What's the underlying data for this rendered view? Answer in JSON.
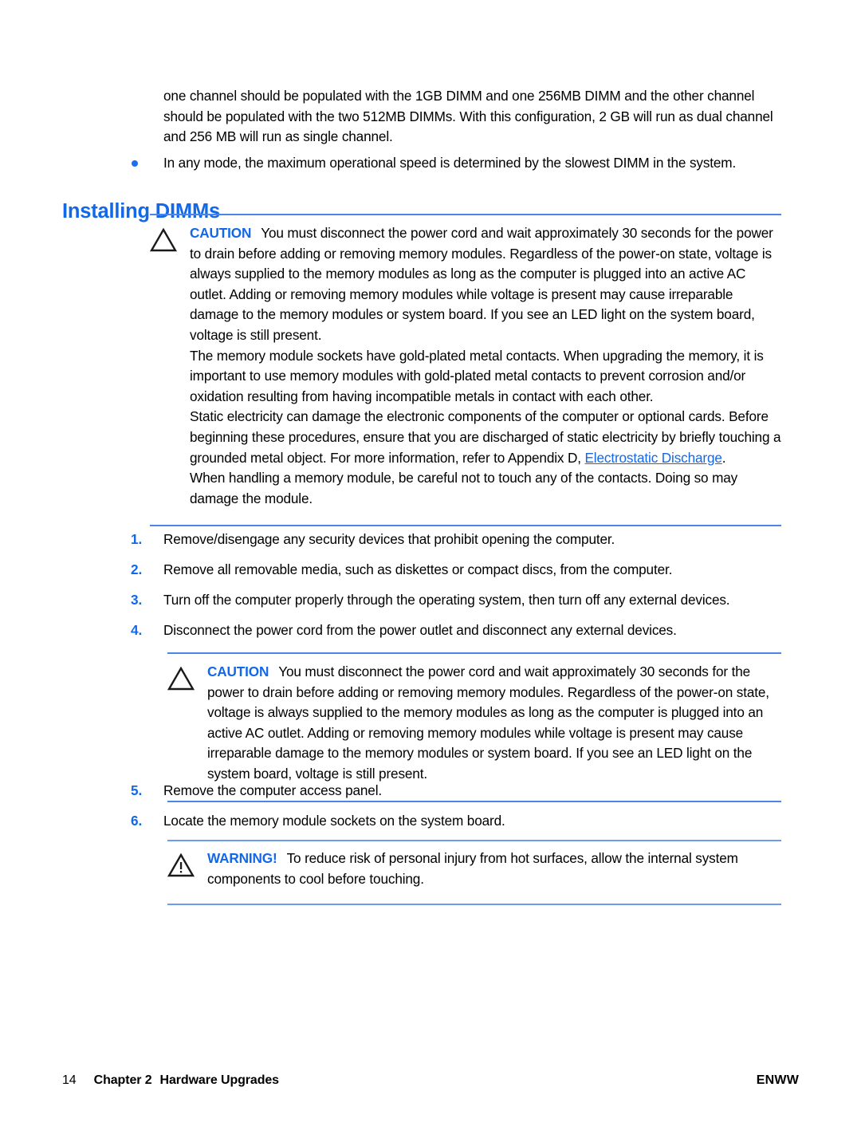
{
  "page": {
    "intro_paragraph": "one channel should be populated with the 1GB DIMM and one 256MB DIMM and the other channel should be populated with the two 512MB DIMMs. With this configuration, 2 GB will run as dual channel and 256 MB will run as single channel.",
    "bullet_item": "In any mode, the maximum operational speed is determined by the slowest DIMM in the system.",
    "section_heading": "Installing DIMMs"
  },
  "caution_1": {
    "label": "CAUTION",
    "icon": "caution-triangle-icon",
    "text": "You must disconnect the power cord and wait approximately 30 seconds for the power to drain before adding or removing memory modules. Regardless of the power-on state, voltage is always supplied to the memory modules as long as the computer is plugged into an active AC outlet. Adding or removing memory modules while voltage is present may cause irreparable damage to the memory modules or system board. If you see an LED light on the system board, voltage is still present.",
    "para_2": "The memory module sockets have gold-plated metal contacts. When upgrading the memory, it is important to use memory modules with gold-plated metal contacts to prevent corrosion and/or oxidation resulting from having incompatible metals in contact with each other.",
    "para_3_before_link": "Static electricity can damage the electronic components of the computer or optional cards. Before beginning these procedures, ensure that you are discharged of static electricity by briefly touching a grounded metal object. For more information, refer to Appendix D, ",
    "para_3_link": "Electrostatic Discharge",
    "para_3_after_link": ".",
    "para_4": "When handling a memory module, be careful not to touch any of the contacts. Doing so may damage the module."
  },
  "steps_first": [
    {
      "num": "1.",
      "text": "Remove/disengage any security devices that prohibit opening the computer."
    },
    {
      "num": "2.",
      "text": "Remove all removable media, such as diskettes or compact discs, from the computer."
    },
    {
      "num": "3.",
      "text": "Turn off the computer properly through the operating system, then turn off any external devices."
    },
    {
      "num": "4.",
      "text": "Disconnect the power cord from the power outlet and disconnect any external devices."
    }
  ],
  "caution_2": {
    "label": "CAUTION",
    "icon": "caution-triangle-icon",
    "text": "You must disconnect the power cord and wait approximately 30 seconds for the power to drain before adding or removing memory modules. Regardless of the power-on state, voltage is always supplied to the memory modules as long as the computer is plugged into an active AC outlet. Adding or removing memory modules while voltage is present may cause irreparable damage to the memory modules or system board. If you see an LED light on the system board, voltage is still present."
  },
  "steps_second": [
    {
      "num": "5.",
      "text": "Remove the computer access panel."
    },
    {
      "num": "6.",
      "text": "Locate the memory module sockets on the system board."
    }
  ],
  "warning": {
    "label": "WARNING!",
    "icon": "warning-triangle-icon",
    "text": "To reduce risk of personal injury from hot surfaces, allow the internal system components to cool before touching."
  },
  "footer": {
    "page_number": "14",
    "chapter": "Chapter 2",
    "chapter_title": "Hardware Upgrades",
    "right_label": "ENWW"
  },
  "colors": {
    "heading_blue": "#1268e8",
    "rule_blue": "#4a86e8",
    "link_blue": "#1568e8",
    "bullet_blue": "#1a6ef0"
  }
}
